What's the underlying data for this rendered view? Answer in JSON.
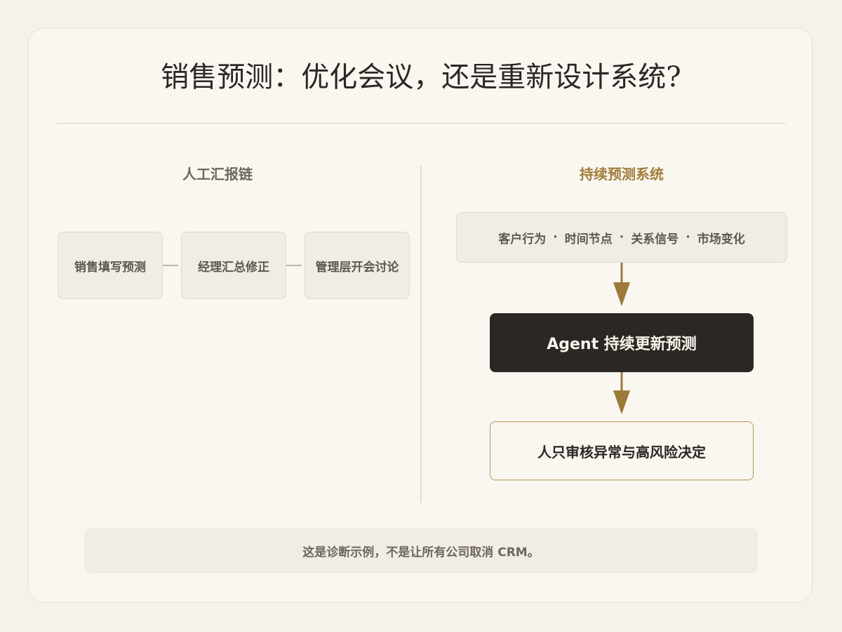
{
  "title": "销售预测：优化会议，还是重新设计系统?",
  "left_column": {
    "heading": "人工汇报链",
    "steps": [
      "销售填写预测",
      "经理汇总修正",
      "管理层开会讨论"
    ]
  },
  "right_column": {
    "heading": "持续预测系统",
    "signals": [
      "客户行为",
      "时间节点",
      "关系信号",
      "市场变化"
    ],
    "separator": "·",
    "agent_box": "Agent 持续更新预测",
    "review_box": "人只审核异常与高风险决定"
  },
  "footnote": "这是诊断示例，不是让所有公司取消 CRM。",
  "colors": {
    "accent": "#a07d3c",
    "dark_box": "#2b2824",
    "arrow": "#9c7a3a"
  }
}
